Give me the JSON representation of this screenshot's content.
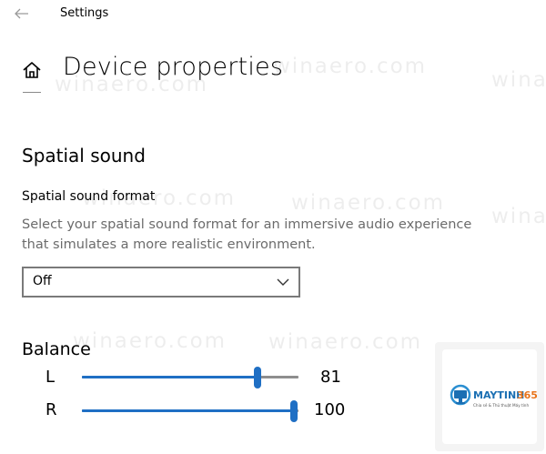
{
  "app": {
    "title": "Settings"
  },
  "header": {
    "page_title": "Device properties"
  },
  "spatial_sound": {
    "heading": "Spatial sound",
    "format_label": "Spatial sound format",
    "description": "Select your spatial sound format for an immersive audio experience that simulates a more realistic environment.",
    "format_value": "Off"
  },
  "balance": {
    "label": "Balance",
    "max": 100,
    "channels": [
      {
        "letter": "L",
        "value": 81,
        "value_text": "81"
      },
      {
        "letter": "R",
        "value": 100,
        "value_text": "100"
      }
    ]
  },
  "watermark": {
    "text": "winaero.com"
  },
  "logo": {
    "brand": "MAYTINH365",
    "tagline": "Chia sẻ & Thủ thuật Máy tính"
  },
  "colors": {
    "accent": "#1F6FC4",
    "track": "#8E8E8E",
    "text_secondary": "#6B6B6B"
  }
}
